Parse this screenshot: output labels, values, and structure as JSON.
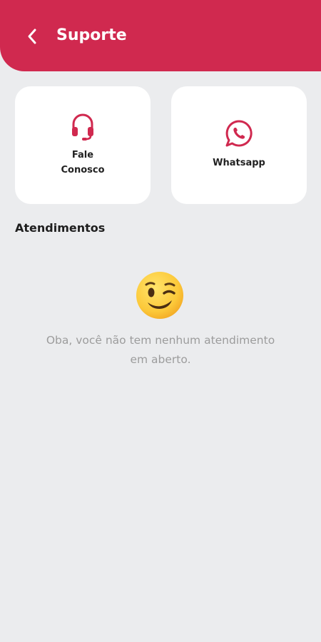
{
  "header": {
    "title": "Suporte",
    "back_icon": "chevron-left-icon",
    "background": "#d0294f"
  },
  "cards": [
    {
      "id": "fale-conosco",
      "label_lines": [
        "Fale",
        "Conosco"
      ],
      "icon": "headset-icon"
    },
    {
      "id": "whatsapp",
      "label_lines": [
        "Whatsapp"
      ],
      "icon": "whatsapp-icon"
    }
  ],
  "section": {
    "title": "Atendimentos"
  },
  "empty_state": {
    "icon": "winking-face-emoji",
    "message_lines": [
      "Oba, você não tem nenhum atendimento",
      "em aberto."
    ]
  },
  "colors": {
    "accent": "#d0294f",
    "background": "#ebecee",
    "card": "#ffffff",
    "muted_text": "#9c9c9c"
  }
}
